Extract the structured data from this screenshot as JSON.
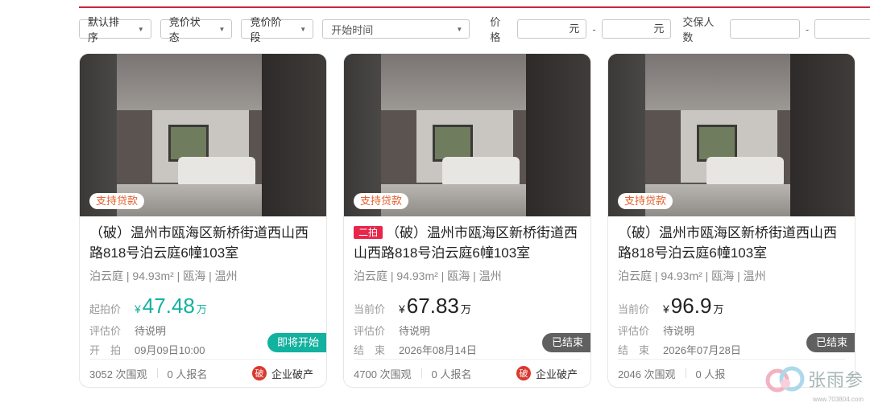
{
  "filters": {
    "sort": "默认排序",
    "bid_status": "竞价状态",
    "bid_stage": "竞价阶段",
    "start_time_placeholder": "开始时间",
    "price_label": "价格",
    "price_min_unit": "元",
    "price_max_unit": "元",
    "price_dash": "-",
    "deposit_label": "交保人数",
    "deposit_dash": "-"
  },
  "cards": [
    {
      "loan_badge": "支持贷款",
      "tag": "",
      "title": "（破）温州市瓯海区新桥街道西山西路818号泊云庭6幢103室",
      "meta": "泊云庭 | 94.93m² | 瓯海 | 温州",
      "price_label": "起拍价",
      "price_yen": "¥",
      "price_value": "47.48",
      "price_unit": "万",
      "eval_label": "评估价",
      "eval_value": "待说明",
      "time_label": "开　拍",
      "time_value": "09月09日10:00",
      "status": "即将开始",
      "views": "3052 次围观",
      "signups": "0 人报名",
      "bank_icon": "破",
      "bank_text": "企业破产"
    },
    {
      "loan_badge": "支持贷款",
      "tag": "二拍",
      "title": "（破）温州市瓯海区新桥街道西山西路818号泊云庭6幢103室",
      "meta": "泊云庭 | 94.93m² | 瓯海 | 温州",
      "price_label": "当前价",
      "price_yen": "¥",
      "price_value": "67.83",
      "price_unit": "万",
      "eval_label": "评估价",
      "eval_value": "待说明",
      "time_label": "结　束",
      "time_value": "2026年08月14日",
      "status": "已结束",
      "views": "4700 次围观",
      "signups": "0 人报名",
      "bank_icon": "破",
      "bank_text": "企业破产"
    },
    {
      "loan_badge": "支持贷款",
      "tag": "",
      "title": "（破）温州市瓯海区新桥街道西山西路818号泊云庭6幢103室",
      "meta": "泊云庭 | 94.93m² | 瓯海 | 温州",
      "price_label": "当前价",
      "price_yen": "¥",
      "price_value": "96.9",
      "price_unit": "万",
      "eval_label": "评估价",
      "eval_value": "待说明",
      "time_label": "结　束",
      "time_value": "2026年07月28日",
      "status": "已结束",
      "views": "2046 次围观",
      "signups": "0 人报",
      "bank_icon": "",
      "bank_text": ""
    }
  ],
  "watermark": {
    "text": "张雨参",
    "url": "www.703804.com"
  },
  "colors": {
    "accent": "#c9263f",
    "green": "#13b19f",
    "tag_red": "#e8264a",
    "status_gray": "#606060"
  }
}
